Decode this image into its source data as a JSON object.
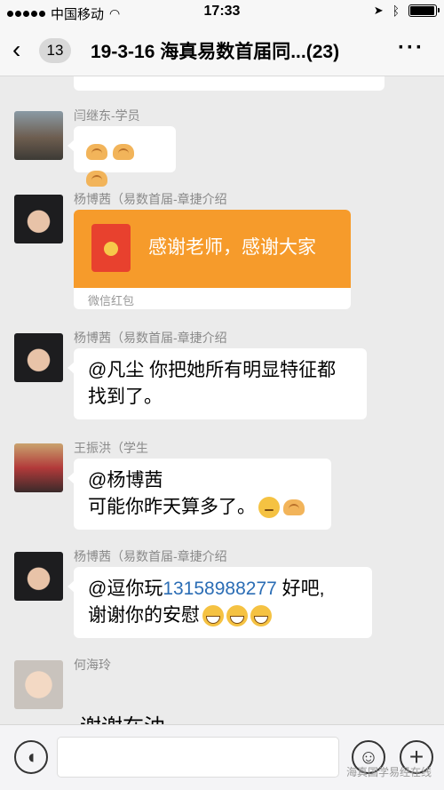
{
  "status_bar": {
    "carrier": "中国移动",
    "time": "17:33",
    "battery_level": 0.95
  },
  "header": {
    "back_icon": "chevron-left-icon",
    "unread_count": "13",
    "title": "19-3-16 海真易数首届同...(23)",
    "more_icon": "ellipsis-icon"
  },
  "messages": [
    {
      "sender": "闫继东-学员",
      "type": "emoji-only",
      "emoji_icon": "handshake-icon",
      "emoji_count": 3
    },
    {
      "sender": "杨博茜（易数首届-章捷介绍",
      "type": "red-packet",
      "packet_text": "感谢老师，感谢大家",
      "packet_label": "微信红包"
    },
    {
      "sender": "杨博茜（易数首届-章捷介绍",
      "type": "text",
      "line1": "@凡尘 你把她所有明显特征都",
      "line2": "找到了。"
    },
    {
      "sender": "王振洪（学生",
      "type": "text",
      "line1": "@杨博茜",
      "line2": "可能你昨天算多了。",
      "emojis": [
        "thinking-face-icon",
        "clapping-hands-icon"
      ]
    },
    {
      "sender": "杨博茜（易数首届-章捷介绍",
      "type": "text",
      "line1_prefix": "@逗你玩",
      "phone": "13158988277",
      "line1_suffix": " 好吧,",
      "line2": "谢谢你的安慰",
      "emojis": [
        "grinning-face-icon",
        "grinning-face-icon",
        "grinning-face-icon"
      ]
    },
    {
      "sender": "何海玲",
      "type": "text",
      "partial_text": "谢谢在油"
    }
  ],
  "input_bar": {
    "voice_icon": "voice-icon",
    "emoji_icon": "smiley-icon",
    "plus_icon": "plus-icon",
    "watermark": "海真国学易经在线"
  },
  "colors": {
    "background": "#ebebeb",
    "red_packet": "#f69b2b",
    "phone_link": "#2b6db5"
  }
}
